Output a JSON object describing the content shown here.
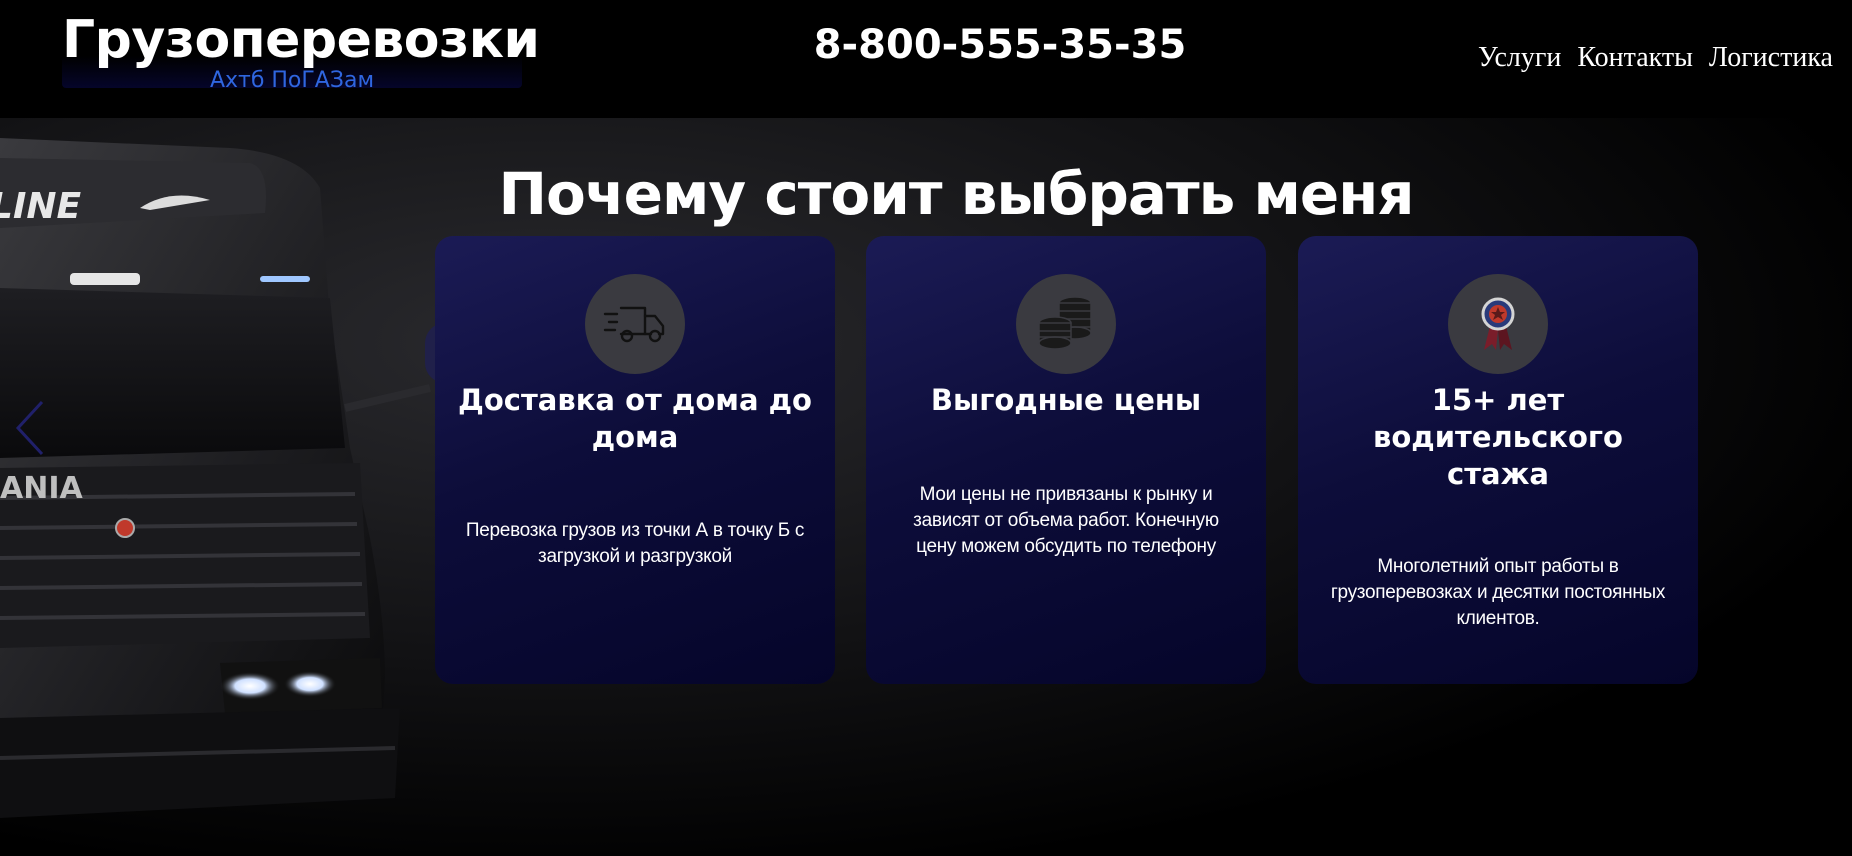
{
  "header": {
    "logo_title": "Грузоперевозки",
    "logo_subtitle": "Ахтб ПоГАЗам",
    "phone": "8-800-555-35-35",
    "nav": [
      "Услуги",
      "Контакты",
      "Логистика"
    ]
  },
  "section": {
    "title": "Почему стоит выбрать меня",
    "cards": [
      {
        "icon": "delivery-truck-icon",
        "heading": "Доставка от дома до дома",
        "text": "Перевозка грузов из точки А в точку Б с загрузкой и разгрузкой"
      },
      {
        "icon": "coins-stack-icon",
        "heading": "Выгодные цены",
        "text": "Мои цены не привязаны к рынку и зависят от объема работ. Конечную цену можем обсудить по телефону"
      },
      {
        "icon": "award-medal-icon",
        "heading": "15+ лет водительского стажа",
        "text": "Многолетний опыт работы в грузоперевозках и десятки постоянных клиентов."
      }
    ]
  },
  "colors": {
    "background": "#000000",
    "accent_blue": "#2f66e0",
    "card_bg": "#0d0d3a",
    "icon_circle": "#3a3a40"
  }
}
